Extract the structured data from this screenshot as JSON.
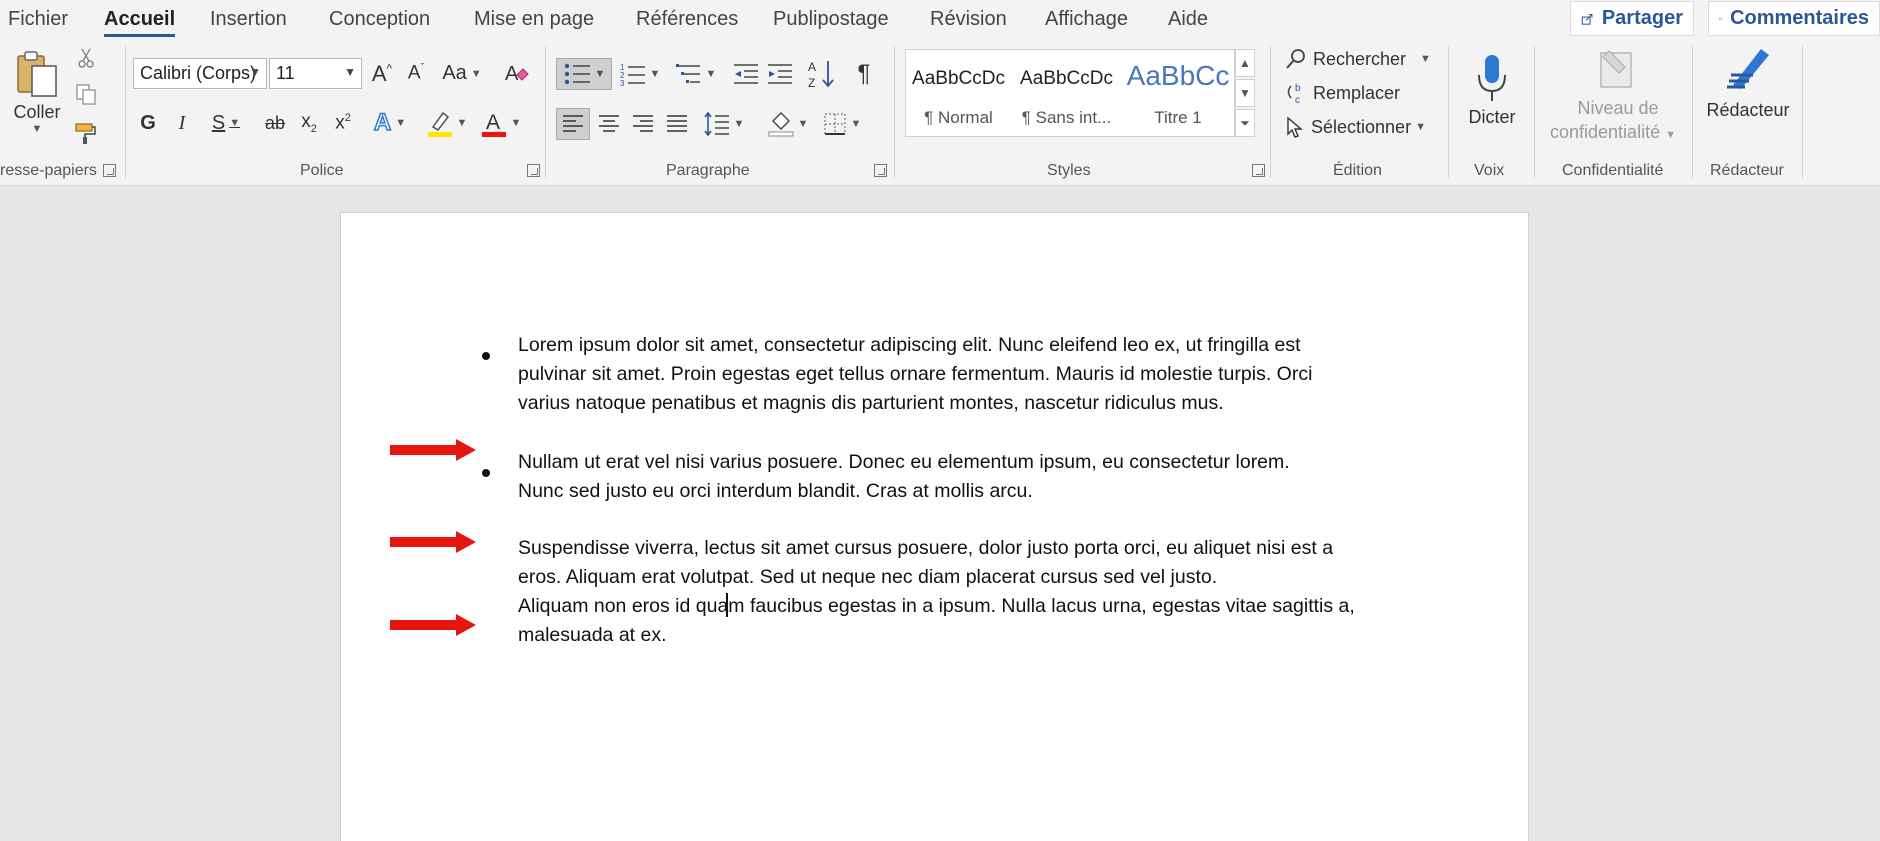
{
  "menu": {
    "tabs": [
      "Fichier",
      "Accueil",
      "Insertion",
      "Conception",
      "Mise en page",
      "Références",
      "Publipostage",
      "Révision",
      "Affichage",
      "Aide"
    ],
    "active": "Accueil",
    "share_label": "Partager",
    "comments_label": "Commentaires"
  },
  "ribbon": {
    "clipboard": {
      "paste_label": "Coller",
      "group_label": "resse-papiers"
    },
    "font": {
      "family": "Calibri (Corps)",
      "size": "11",
      "group_label": "Police",
      "bold": "G",
      "italic": "I",
      "underline": "S",
      "strike": "ab",
      "case": "Aa"
    },
    "paragraph": {
      "group_label": "Paragraphe"
    },
    "styles": {
      "group_label": "Styles",
      "items": [
        {
          "preview": "AaBbCcDc",
          "name": "¶ Normal"
        },
        {
          "preview": "AaBbCcDc",
          "name": "¶ Sans int..."
        },
        {
          "preview": "AaBbCc",
          "name": "Titre 1"
        }
      ]
    },
    "editing": {
      "group_label": "Édition",
      "find": "Rechercher",
      "replace": "Remplacer",
      "select": "Sélectionner"
    },
    "voice": {
      "group_label": "Voix",
      "dictate": "Dicter"
    },
    "sensitivity": {
      "group_label": "Confidentialité",
      "line1": "Niveau de",
      "line2": "confidentialité"
    },
    "editor": {
      "group_label": "Rédacteur",
      "label": "Rédacteur"
    }
  },
  "document": {
    "paragraphs": [
      {
        "bulleted": true,
        "lines": [
          "Lorem ipsum dolor sit amet, consectetur adipiscing elit. Nunc eleifend leo ex, ut fringilla est",
          "pulvinar sit amet. Proin egestas eget tellus ornare fermentum. Mauris id molestie turpis. Orci",
          "varius natoque penatibus et magnis dis parturient montes, nascetur ridiculus mus."
        ]
      },
      {
        "bulleted": true,
        "lines": [
          "Nullam ut erat vel nisi varius posuere. Donec eu elementum ipsum, eu consectetur lorem.",
          "Nunc sed justo eu orci interdum blandit. Cras at mollis arcu."
        ]
      },
      {
        "bulleted": false,
        "lines": [
          "Suspendisse viverra, lectus sit amet cursus posuere, dolor justo porta orci, eu aliquet nisi est a",
          "eros. Aliquam erat volutpat. Sed ut neque nec diam placerat cursus sed vel justo."
        ]
      },
      {
        "bulleted": false,
        "lines": [
          "Aliquam non eros id quam faucibus egestas in a ipsum. Nulla lacus urna, egestas vitae sagittis a,",
          "malesuada at ex."
        ]
      }
    ],
    "arrow_color": "#e8150f"
  },
  "colors": {
    "accent": "#2b579a",
    "highlight": "#ffe600",
    "font_color": "#e8150f"
  }
}
